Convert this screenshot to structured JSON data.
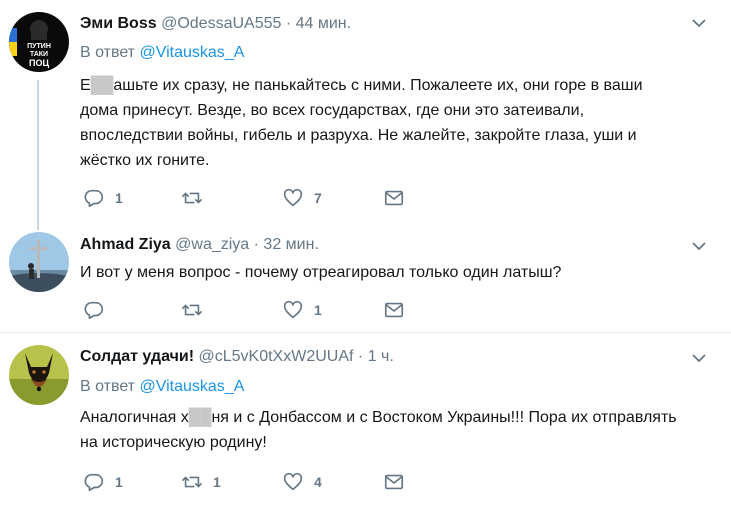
{
  "tweets": [
    {
      "name": "Эми Boss",
      "handle": "@OdessaUA555",
      "sep": "·",
      "time": "44 мин.",
      "reply_prefix": "В ответ",
      "reply_to": "@Vitauskas_A",
      "text_parts": [
        "Е",
        "██",
        "ашьте их сразу, не панькайтесь с ними. Пожалеете их, они горе в ваши дома принесут. Везде, во всех государствах, где они это затеивали, впоследствии войны, гибель и разруха. Не жалейте, закройте глаза, уши и жёстко их гоните."
      ],
      "avatar_text": [
        "ПУТИН",
        "ТАКИ",
        "ПОЦ"
      ],
      "replies": "1",
      "retweets": "",
      "likes": "7"
    },
    {
      "name": "Ahmad Ziya",
      "handle": "@wa_ziya",
      "sep": "·",
      "time": "32 мин.",
      "text": "И вот у меня вопрос - почему отреагировал только один латыш?",
      "replies": "",
      "retweets": "",
      "likes": "1"
    },
    {
      "name": "Солдат удачи!",
      "handle": "@cL5vK0tXxW2UUAf",
      "sep": "·",
      "time": "1 ч.",
      "reply_prefix": "В ответ",
      "reply_to": "@Vitauskas_A",
      "text_parts": [
        "Аналогичная х",
        "██",
        "ня и с Донбассом и с Востоком Украины!!! Пора их отправлять на историческую родину!"
      ],
      "replies": "1",
      "retweets": "1",
      "likes": "4"
    }
  ],
  "colors": {
    "accent": "#1b95e0",
    "muted": "#657786",
    "divider": "#e6ecf0"
  },
  "icons": {
    "reply": "reply-icon",
    "retweet": "retweet-icon",
    "like": "heart-icon",
    "dm": "envelope-icon",
    "menu": "chevron-down-icon"
  }
}
